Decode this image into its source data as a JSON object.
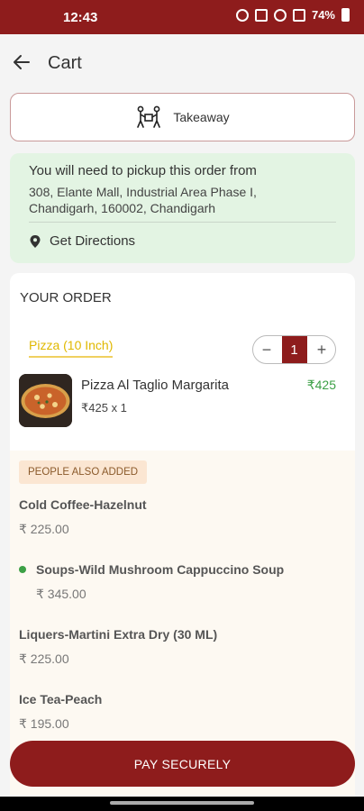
{
  "status_bar": {
    "time": "12:43",
    "battery": "74%"
  },
  "header": {
    "title": "Cart"
  },
  "order_type": {
    "label": "Takeaway"
  },
  "pickup": {
    "title": "You will need to pickup this order from",
    "address_line1": "308, Elante Mall, Industrial Area Phase I,",
    "address_line2": "Chandigarh, 160002, Chandigarh",
    "directions_label": "Get Directions"
  },
  "order": {
    "title": "YOUR ORDER",
    "category": "Pizza (10 Inch)",
    "item": {
      "name": "Pizza Al Taglio Margarita",
      "price": "₹425",
      "unit_line": "₹425 x 1",
      "quantity": "1"
    }
  },
  "also_added": {
    "badge": "PEOPLE ALSO ADDED",
    "items": [
      {
        "name": "Cold Coffee-Hazelnut",
        "price": "₹ 225.00"
      },
      {
        "name": "Soups-Wild Mushroom Cappuccino Soup",
        "price": "₹ 345.00"
      },
      {
        "name": "Liquers-Martini Extra Dry (30 ML)",
        "price": "₹ 225.00"
      },
      {
        "name": "Ice Tea-Peach",
        "price": "₹ 195.00"
      }
    ]
  },
  "pay_button": {
    "label": "PAY SECURELY"
  },
  "colors": {
    "brand": "#8e1c1c",
    "veg_green": "#3ca046",
    "pickup_bg": "#e3f4e3",
    "category_yellow": "#e0b800"
  }
}
